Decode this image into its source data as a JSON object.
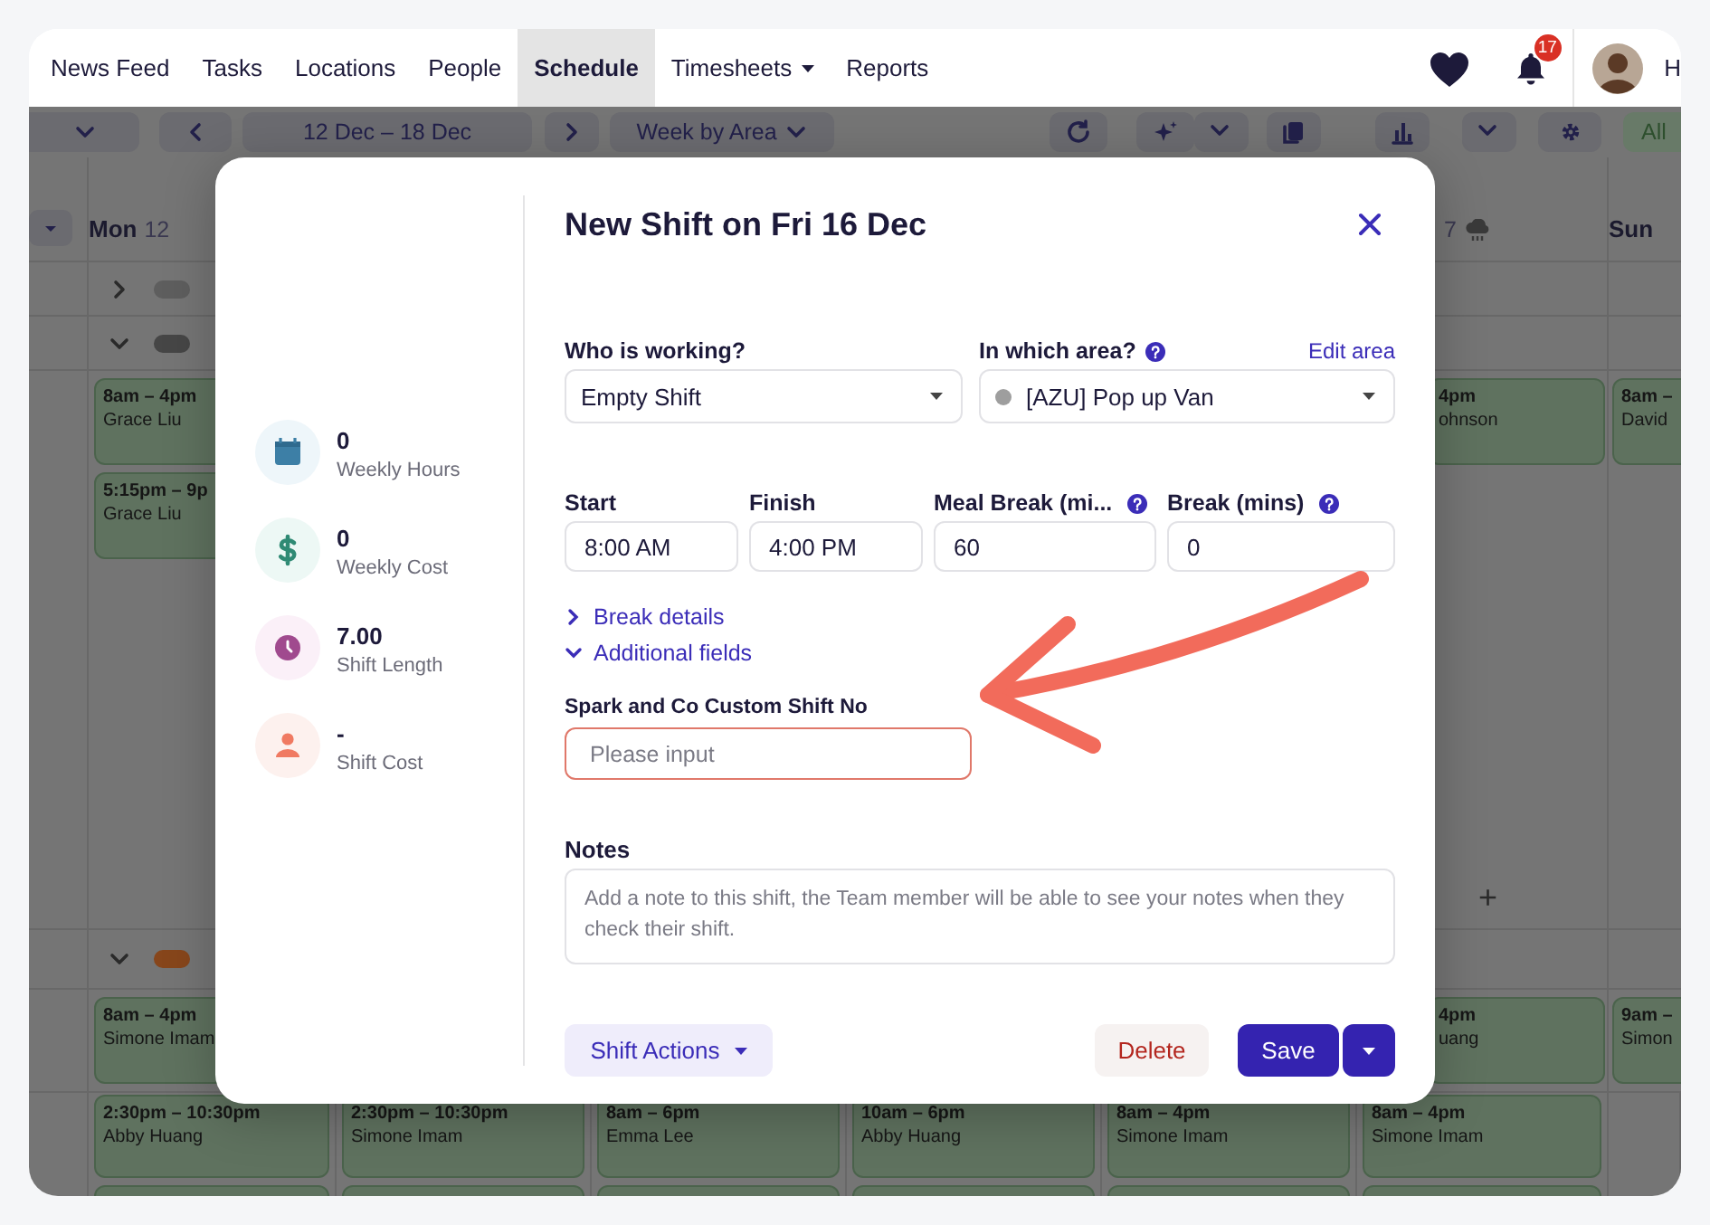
{
  "nav": {
    "items": [
      {
        "label": "News Feed",
        "selected": false,
        "has_menu": false
      },
      {
        "label": "Tasks",
        "selected": false,
        "has_menu": false
      },
      {
        "label": "Locations",
        "selected": false,
        "has_menu": false
      },
      {
        "label": "People",
        "selected": false,
        "has_menu": false
      },
      {
        "label": "Schedule",
        "selected": true,
        "has_menu": false
      },
      {
        "label": "Timesheets",
        "selected": false,
        "has_menu": true
      },
      {
        "label": "Reports",
        "selected": false,
        "has_menu": false
      }
    ],
    "notification_count": "17",
    "user_name": "H"
  },
  "toolbar": {
    "date_range": "12 Dec – 18 Dec",
    "view": "Week by Area",
    "filter": "All"
  },
  "schedule": {
    "day_headers": [
      {
        "day": "Mon",
        "date": "12",
        "weather": false
      },
      {
        "date": "7",
        "weather": true
      },
      {
        "day": "Sun",
        "weather": false
      }
    ],
    "groups": [
      {
        "expanded": false,
        "color": "#5e5e5e"
      },
      {
        "expanded": true,
        "color": "#464646",
        "add_label": "+",
        "left_shifts": [
          {
            "time": "8am – 4pm",
            "name": "Grace Liu"
          },
          {
            "time": "5:15pm – 9p",
            "name": "Grace Liu"
          }
        ],
        "right_shifts": [
          {
            "time": "4pm",
            "name": "ohnson"
          },
          {
            "time": "8am –",
            "name": "David"
          }
        ]
      },
      {
        "expanded": true,
        "color": "#87461b",
        "left_shifts": [
          {
            "time": "8am – 4pm",
            "name": "Simone Imam"
          }
        ],
        "right_shifts": [
          {
            "time": "4pm",
            "name": "uang"
          },
          {
            "time": "9am –",
            "name": "Simon"
          }
        ]
      }
    ],
    "bottom_row": [
      {
        "time": "2:30pm – 10:30pm",
        "name": "Abby Huang"
      },
      {
        "time": "2:30pm – 10:30pm",
        "name": "Simone Imam"
      },
      {
        "time": "8am – 6pm",
        "name": "Emma Lee"
      },
      {
        "time": "10am – 6pm",
        "name": "Abby Huang"
      },
      {
        "time": "8am – 4pm",
        "name": "Simone Imam"
      },
      {
        "time": "8am – 4pm",
        "name": "Simone Imam"
      }
    ]
  },
  "modal": {
    "title": "New Shift on Fri 16 Dec",
    "stats": [
      {
        "kind": "hours",
        "value": "0",
        "label": "Weekly Hours"
      },
      {
        "kind": "cost",
        "value": "0",
        "label": "Weekly Cost"
      },
      {
        "kind": "length",
        "value": "7.00",
        "label": "Shift Length"
      },
      {
        "kind": "shift_cost",
        "value": "-",
        "label": "Shift Cost"
      }
    ],
    "who": {
      "label": "Who is working?",
      "value": "Empty Shift"
    },
    "area": {
      "label": "In which area?",
      "link": "Edit area",
      "value": "[AZU] Pop up Van"
    },
    "times": [
      {
        "label": "Start",
        "value": "8:00 AM",
        "help": false
      },
      {
        "label": "Finish",
        "value": "4:00 PM",
        "help": false
      },
      {
        "label": "Meal Break (mi...",
        "value": "60",
        "help": true
      },
      {
        "label": "Break (mins)",
        "value": "0",
        "help": true
      }
    ],
    "sections": [
      {
        "label": "Break details",
        "expanded": false
      },
      {
        "label": "Additional fields",
        "expanded": true
      }
    ],
    "custom_field": {
      "label": "Spark and Co Custom Shift No",
      "placeholder": "Please input",
      "highlighted": true
    },
    "notes": {
      "label": "Notes",
      "placeholder": "Add a note to this shift, the Team member will be able to see your notes when they check their shift."
    },
    "actions": {
      "menu": "Shift Actions",
      "delete": "Delete",
      "save": "Save"
    }
  }
}
